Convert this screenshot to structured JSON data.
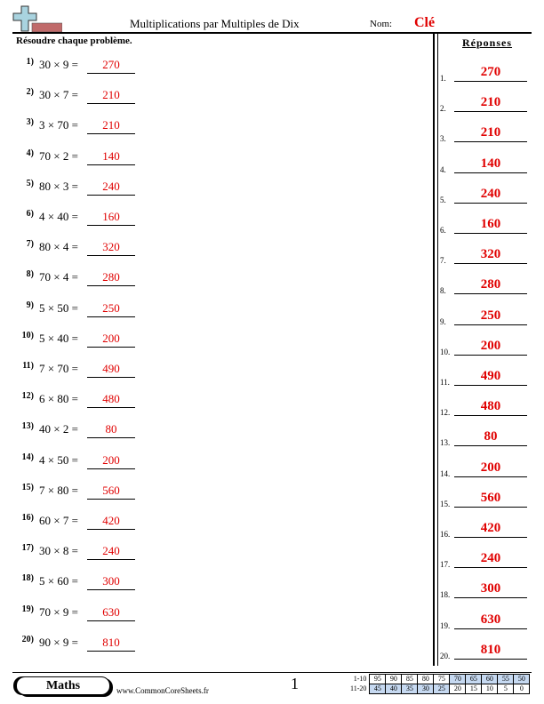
{
  "header": {
    "title": "Multiplications par Multiples de Dix",
    "nom_label": "Nom:",
    "nom_value": "Clé",
    "logo_icon": "plus-sign-logo-icon"
  },
  "instructions": "Résoudre chaque problème.",
  "problems": [
    {
      "num": "1)",
      "expr": "30 × 9 =",
      "answer": "270"
    },
    {
      "num": "2)",
      "expr": "30 × 7 =",
      "answer": "210"
    },
    {
      "num": "3)",
      "expr": "3 × 70 =",
      "answer": "210"
    },
    {
      "num": "4)",
      "expr": "70 × 2 =",
      "answer": "140"
    },
    {
      "num": "5)",
      "expr": "80 × 3 =",
      "answer": "240"
    },
    {
      "num": "6)",
      "expr": "4 × 40 =",
      "answer": "160"
    },
    {
      "num": "7)",
      "expr": "80 × 4 =",
      "answer": "320"
    },
    {
      "num": "8)",
      "expr": "70 × 4 =",
      "answer": "280"
    },
    {
      "num": "9)",
      "expr": "5 × 50 =",
      "answer": "250"
    },
    {
      "num": "10)",
      "expr": "5 × 40 =",
      "answer": "200"
    },
    {
      "num": "11)",
      "expr": "7 × 70 =",
      "answer": "490"
    },
    {
      "num": "12)",
      "expr": "6 × 80 =",
      "answer": "480"
    },
    {
      "num": "13)",
      "expr": "40 × 2 =",
      "answer": "80"
    },
    {
      "num": "14)",
      "expr": "4 × 50 =",
      "answer": "200"
    },
    {
      "num": "15)",
      "expr": "7 × 80 =",
      "answer": "560"
    },
    {
      "num": "16)",
      "expr": "60 × 7 =",
      "answer": "420"
    },
    {
      "num": "17)",
      "expr": "30 × 8 =",
      "answer": "240"
    },
    {
      "num": "18)",
      "expr": "5 × 60 =",
      "answer": "300"
    },
    {
      "num": "19)",
      "expr": "70 × 9 =",
      "answer": "630"
    },
    {
      "num": "20)",
      "expr": "90 × 9 =",
      "answer": "810"
    }
  ],
  "answer_key": {
    "title": "Réponses",
    "items": [
      {
        "num": "1.",
        "answer": "270"
      },
      {
        "num": "2.",
        "answer": "210"
      },
      {
        "num": "3.",
        "answer": "210"
      },
      {
        "num": "4.",
        "answer": "140"
      },
      {
        "num": "5.",
        "answer": "240"
      },
      {
        "num": "6.",
        "answer": "160"
      },
      {
        "num": "7.",
        "answer": "320"
      },
      {
        "num": "8.",
        "answer": "280"
      },
      {
        "num": "9.",
        "answer": "250"
      },
      {
        "num": "10.",
        "answer": "200"
      },
      {
        "num": "11.",
        "answer": "490"
      },
      {
        "num": "12.",
        "answer": "480"
      },
      {
        "num": "13.",
        "answer": "80"
      },
      {
        "num": "14.",
        "answer": "200"
      },
      {
        "num": "15.",
        "answer": "560"
      },
      {
        "num": "16.",
        "answer": "420"
      },
      {
        "num": "17.",
        "answer": "240"
      },
      {
        "num": "18.",
        "answer": "300"
      },
      {
        "num": "19.",
        "answer": "630"
      },
      {
        "num": "20.",
        "answer": "810"
      }
    ]
  },
  "footer": {
    "subject": "Maths",
    "site": "www.CommonCoreSheets.fr",
    "page": "1",
    "score_rows": [
      {
        "label": "1-10",
        "scores": [
          "95",
          "90",
          "85",
          "80",
          "75",
          "70",
          "65",
          "60",
          "55",
          "50"
        ],
        "highlight": [
          false,
          false,
          false,
          false,
          false,
          true,
          true,
          true,
          true,
          true
        ]
      },
      {
        "label": "11-20",
        "scores": [
          "45",
          "40",
          "35",
          "30",
          "25",
          "20",
          "15",
          "10",
          "5",
          "0"
        ],
        "highlight": [
          true,
          true,
          true,
          true,
          true,
          false,
          false,
          false,
          false,
          false
        ]
      }
    ],
    "highlight_color": "#c6d9f1"
  }
}
